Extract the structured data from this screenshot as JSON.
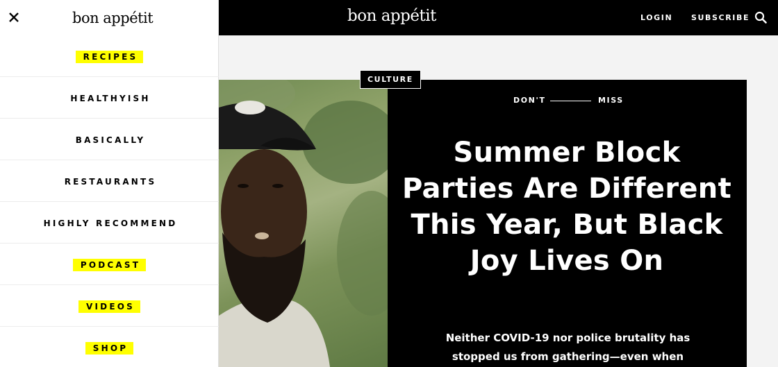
{
  "header": {
    "brand": "bon appétit",
    "login": "LOGIN",
    "subscribe": "SUBSCRIBE",
    "search_icon": "search-icon"
  },
  "menu": {
    "brand": "bon appétit",
    "close_icon": "close-icon",
    "items": [
      {
        "label": "RECIPES",
        "highlighted": true
      },
      {
        "label": "HEALTHYISH",
        "highlighted": false
      },
      {
        "label": "BASICALLY",
        "highlighted": false
      },
      {
        "label": "RESTAURANTS",
        "highlighted": false
      },
      {
        "label": "HIGHLY RECOMMEND",
        "highlighted": false
      },
      {
        "label": "PODCAST",
        "highlighted": true
      },
      {
        "label": "VIDEOS",
        "highlighted": true
      },
      {
        "label": "SHOP",
        "highlighted": true
      }
    ],
    "highlight_color": "#ffff00"
  },
  "hero": {
    "tag": "CULTURE",
    "kicker_left": "DON'T",
    "kicker_right": "MISS",
    "headline": "Summer Block Parties Are Different This Year, But Black Joy Lives On",
    "dek": "Neither COVID-19 nor police brutality has stopped us from gathering—even when"
  }
}
